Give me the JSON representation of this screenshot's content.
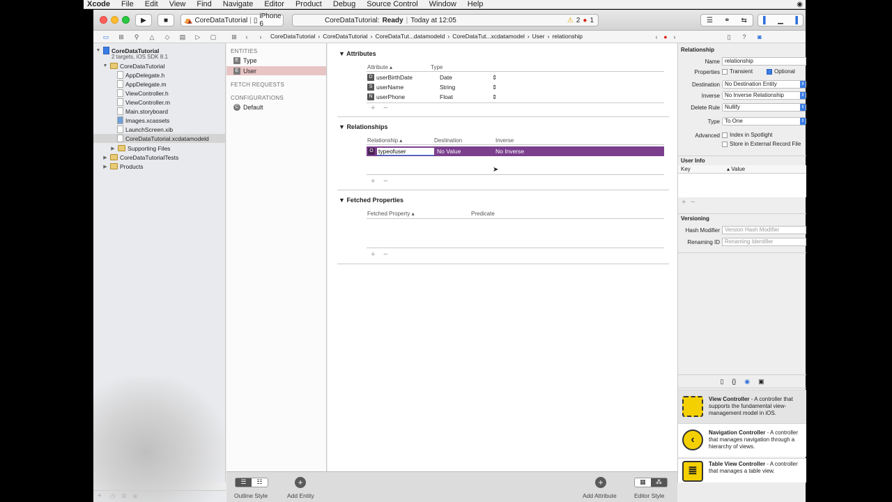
{
  "menubar": {
    "app": "Xcode",
    "items": [
      "File",
      "Edit",
      "View",
      "Find",
      "Navigate",
      "Editor",
      "Product",
      "Debug",
      "Source Control",
      "Window",
      "Help"
    ]
  },
  "toolbar": {
    "scheme": "CoreDataTutorial",
    "device": "iPhone 6",
    "status_project": "CoreDataTutorial:",
    "status_state": "Ready",
    "status_time": "Today at 12:05",
    "warnings": "2",
    "errors": "1"
  },
  "jumpbar": [
    "CoreDataTutorial",
    "CoreDataTutorial",
    "CoreDataTut...datamodeld",
    "CoreDataTut...xcdatamodel",
    "User",
    "relationship"
  ],
  "navigator": {
    "project_name": "CoreDataTutorial",
    "project_sub": "2 targets, iOS SDK 8.1",
    "group": "CoreDataTutorial",
    "files": [
      "AppDelegate.h",
      "AppDelegate.m",
      "ViewController.h",
      "ViewController.m",
      "Main.storyboard",
      "Images.xcassets",
      "LaunchScreen.xib",
      "CoreDataTutorial.xcdatamodeld"
    ],
    "supporting": "Supporting Files",
    "tests": "CoreDataTutorialTests",
    "products": "Products"
  },
  "entities": {
    "heading": "ENTITIES",
    "items": [
      "Type",
      "User"
    ],
    "fetch_heading": "FETCH REQUESTS",
    "config_heading": "CONFIGURATIONS",
    "config_default": "Default"
  },
  "editor": {
    "attributes_title": "Attributes",
    "attr_col1": "Attribute",
    "attr_col2": "Type",
    "attributes": [
      {
        "badge": "D",
        "name": "userBirthDate",
        "type": "Date"
      },
      {
        "badge": "S",
        "name": "userName",
        "type": "String"
      },
      {
        "badge": "N",
        "name": "userPhone",
        "type": "Float"
      }
    ],
    "relationships_title": "Relationships",
    "rel_col1": "Relationship",
    "rel_col2": "Destination",
    "rel_col3": "Inverse",
    "relationship": {
      "badge": "O",
      "name": "typeofuser",
      "destination": "No Value",
      "inverse": "No Inverse"
    },
    "fetched_title": "Fetched Properties",
    "fetched_col1": "Fetched Property",
    "fetched_col2": "Predicate"
  },
  "inspector": {
    "section": "Relationship",
    "name_label": "Name",
    "name_value": "relationship",
    "properties_label": "Properties",
    "transient": "Transient",
    "optional": "Optional",
    "destination_label": "Destination",
    "destination_value": "No Destination Entity",
    "inverse_label": "Inverse",
    "inverse_value": "No Inverse Relationship",
    "delete_label": "Delete Rule",
    "delete_value": "Nullify",
    "type_label": "Type",
    "type_value": "To One",
    "advanced_label": "Advanced",
    "spotlight": "Index in Spotlight",
    "external": "Store in External Record File",
    "userinfo_title": "User Info",
    "key_col": "Key",
    "value_col": "Value",
    "versioning_title": "Versioning",
    "hash_label": "Hash Modifier",
    "hash_placeholder": "Version Hash Modifier",
    "renaming_label": "Renaming ID",
    "renaming_placeholder": "Renaming Identifier"
  },
  "library": [
    {
      "title": "View Controller",
      "desc": " - A controller that supports the fundamental view-management model in iOS."
    },
    {
      "title": "Navigation Controller",
      "desc": " - A controller that manages navigation through a hierarchy of views."
    },
    {
      "title": "Table View Controller",
      "desc": " - A controller that manages a table view."
    }
  ],
  "bottombar": {
    "outline_style": "Outline Style",
    "add_entity": "Add Entity",
    "add_attribute": "Add Attribute",
    "editor_style": "Editor Style"
  }
}
